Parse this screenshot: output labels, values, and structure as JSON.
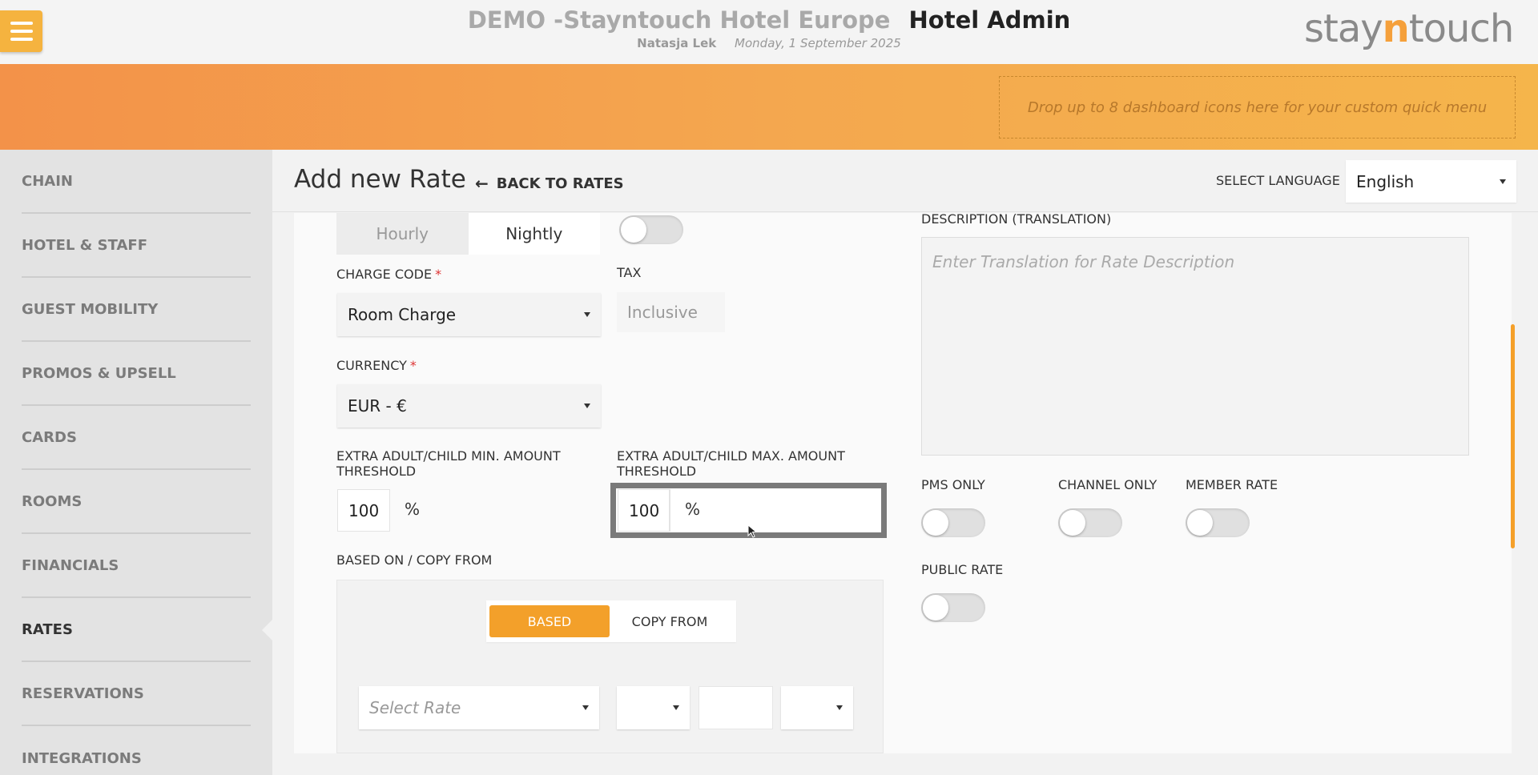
{
  "header": {
    "hotel_name": "DEMO -Stayntouch Hotel Europe",
    "app_name": "Hotel Admin",
    "user": "Natasja Lek",
    "date": "Monday, 1 September 2025",
    "brand_pre": "stay",
    "brand_n": "n",
    "brand_post": "touch"
  },
  "quick_menu": {
    "placeholder": "Drop up to 8 dashboard icons here for your custom quick menu"
  },
  "sidebar": {
    "items": [
      {
        "label": "CHAIN"
      },
      {
        "label": "HOTEL & STAFF"
      },
      {
        "label": "GUEST MOBILITY"
      },
      {
        "label": "PROMOS & UPSELL"
      },
      {
        "label": "CARDS"
      },
      {
        "label": "ROOMS"
      },
      {
        "label": "FINANCIALS"
      },
      {
        "label": "RATES",
        "active": true
      },
      {
        "label": "RESERVATIONS"
      },
      {
        "label": "INTEGRATIONS"
      }
    ]
  },
  "page": {
    "title": "Add new Rate",
    "back_label": "BACK TO RATES",
    "language_label": "SELECT LANGUAGE",
    "language_value": "English"
  },
  "form": {
    "period": {
      "options": [
        "Hourly",
        "Nightly"
      ],
      "selected": "Nightly"
    },
    "charge_code": {
      "label": "CHARGE CODE",
      "required": "*",
      "value": "Room Charge"
    },
    "tax": {
      "label": "TAX",
      "value": "Inclusive"
    },
    "currency": {
      "label": "CURRENCY",
      "required": "*",
      "value": "EUR - €"
    },
    "min_threshold": {
      "label_1": "EXTRA ADULT/CHILD MIN. AMOUNT",
      "label_2": "THRESHOLD",
      "value": "100",
      "unit": "%"
    },
    "max_threshold": {
      "label_1": "EXTRA ADULT/CHILD MAX. AMOUNT",
      "label_2": "THRESHOLD",
      "value": "100",
      "unit": "%"
    },
    "based_on": {
      "label": "BASED ON / COPY FROM",
      "options": [
        "BASED",
        "COPY FROM"
      ],
      "selected": "BASED",
      "rate_placeholder": "Select Rate"
    },
    "description_translation": {
      "label": "DESCRIPTION (TRANSLATION)",
      "placeholder": "Enter Translation for Rate Description"
    },
    "flags": {
      "pms_only": "PMS ONLY",
      "channel_only": "CHANNEL ONLY",
      "member_rate": "MEMBER RATE",
      "public_rate": "PUBLIC RATE"
    }
  },
  "colors": {
    "accent": "#f3a02a",
    "band_start": "#f39249",
    "band_end": "#f5b54b"
  }
}
